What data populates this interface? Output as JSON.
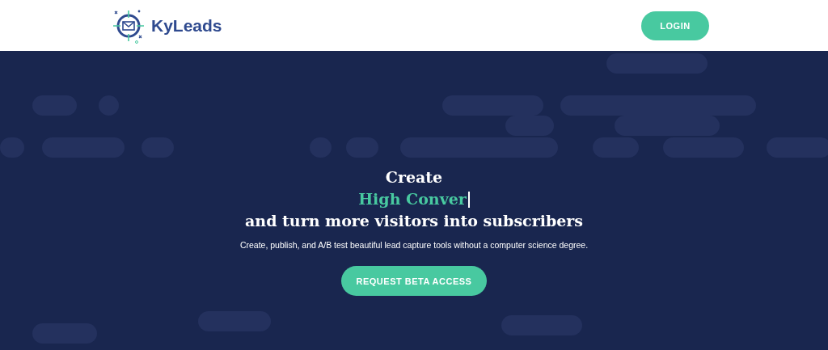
{
  "header": {
    "brand": "KyLeads",
    "login_button": "LOGIN"
  },
  "hero": {
    "title_line_1": "Create",
    "typed_text": "High Conver",
    "title_line_3": "and turn more visitors into subscribers",
    "subtitle": "Create, publish, and A/B test beautiful lead capture tools without a computer science degree.",
    "cta_button": "REQUEST BETA ACCESS"
  }
}
